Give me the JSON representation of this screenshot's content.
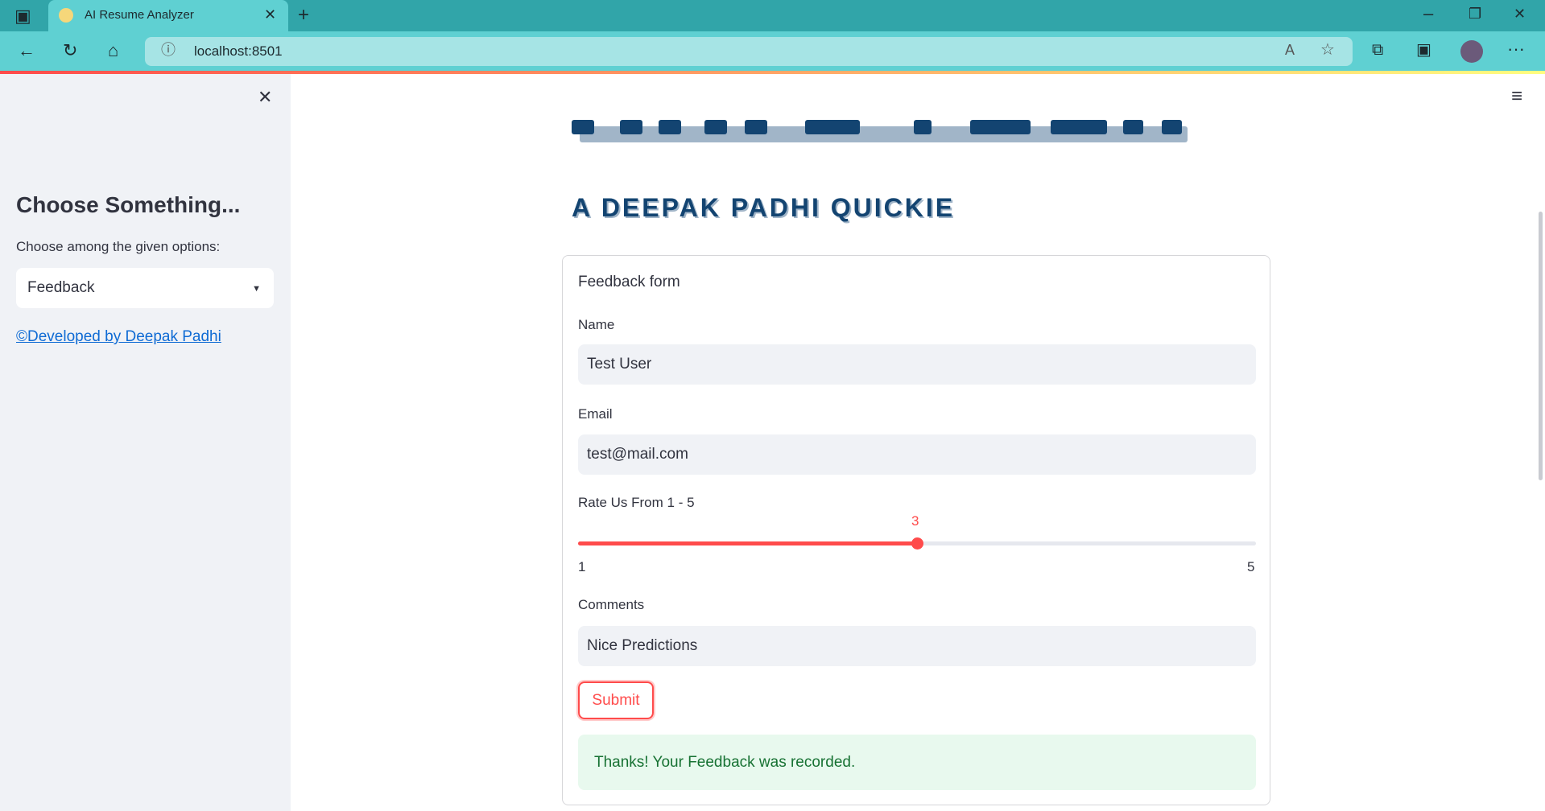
{
  "browser": {
    "tab_title": "AI Resume Analyzer",
    "url": "localhost:8501",
    "icons": [
      "sidebar-toggle-icon",
      "favicon-icon",
      "close-tab-icon",
      "new-tab-icon",
      "minimize-icon",
      "restore-icon",
      "close-window-icon",
      "back-icon",
      "refresh-icon",
      "home-icon",
      "info-icon",
      "read-aloud-icon",
      "favorites-icon",
      "collections-icon",
      "math-solver-icon",
      "profile-avatar",
      "more-icon"
    ]
  },
  "sidebar": {
    "title": "Choose Something...",
    "select_label": "Choose among the given options:",
    "select_value": "Feedback",
    "link": "©Developed by Deepak Padhi"
  },
  "header": {
    "logo_text": "AI RESUME ANALYZER",
    "subtitle": "A DEEPAK PADHI QUICKIE"
  },
  "form": {
    "title": "Feedback form",
    "name_label": "Name",
    "name_value": "Test User",
    "email_label": "Email",
    "email_value": "test@mail.com",
    "rating_label": "Rate Us From 1 - 5",
    "rating_value": "3",
    "rating_min": "1",
    "rating_max": "5",
    "comments_label": "Comments",
    "comments_value": "Nice Predictions",
    "submit_label": "Submit",
    "success_message": "Thanks! Your Feedback was recorded."
  },
  "colors": {
    "accent": "#ff4b4b",
    "logo": "#134471",
    "success_bg": "#e8f9ee",
    "success_text": "#177233"
  }
}
